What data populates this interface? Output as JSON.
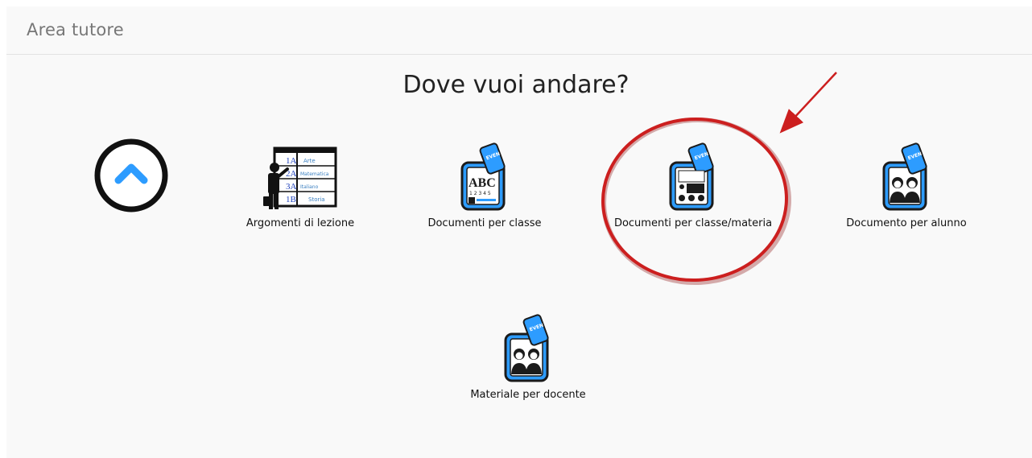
{
  "header": {
    "title": "Area tutore"
  },
  "main": {
    "question": "Dove vuoi andare?"
  },
  "tiles": [
    {
      "label": "Argomenti di lezione"
    },
    {
      "label": "Documenti per classe"
    },
    {
      "label": "Documenti per classe/materia"
    },
    {
      "label": "Documento per alunno"
    },
    {
      "label": "Materiale per docente"
    }
  ],
  "icons": {
    "back": "chevron-up-icon",
    "badge_text": "EVEN",
    "board_rows": [
      "1A",
      "2A",
      "3A",
      "1B"
    ],
    "board_subjects": [
      "Arte",
      "Matematica",
      "Italiano",
      "Storia"
    ],
    "abc_text": "ABC",
    "numbers_text": "1 2 3 4 5"
  },
  "colors": {
    "accent": "#2d9cff",
    "dark": "#1b1b1b",
    "annotation": "#cc1f1f"
  }
}
